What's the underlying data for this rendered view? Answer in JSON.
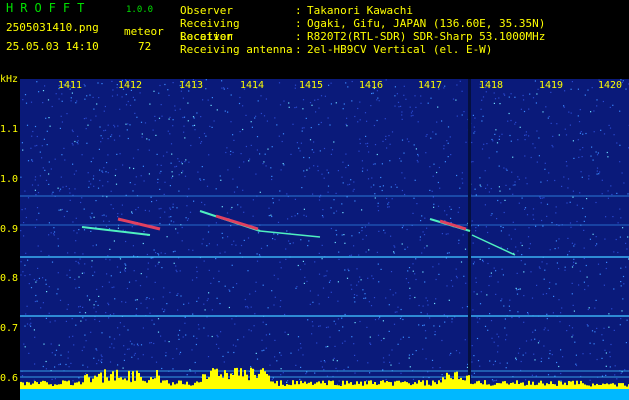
{
  "header": {
    "logo": "HROFFT",
    "version": "1.0.0",
    "filename": "2505031410.png",
    "datetime": "25.05.03 14:10",
    "meteor_label": "meteor",
    "meteor_count": "72"
  },
  "observation": [
    {
      "key": "Observer",
      "value": "Takanori Kawachi"
    },
    {
      "key": "Receiving Location",
      "value": "Ogaki, Gifu, JAPAN (136.60E, 35.35N)"
    },
    {
      "key": "Receiver",
      "value": "R820T2(RTL-SDR) SDR-Sharp 53.1000MHz"
    },
    {
      "key": "Receiving antenna",
      "value": "2el-HB9CV Vertical (el. E-W)"
    }
  ],
  "axis": {
    "y_unit": "kHz",
    "y_ticks": [
      "1.1",
      "1.0",
      "0.9",
      "0.8",
      "0.7",
      "0.6"
    ],
    "x_ticks": [
      "1411",
      "1412",
      "1413",
      "1414",
      "1415",
      "1416",
      "1417",
      "1418",
      "1419",
      "1420"
    ]
  },
  "colors": {
    "background": "#000000",
    "text": "#ffff00",
    "logo": "#00e000",
    "spectrogram": "#0a1a7a",
    "histogram": "#ffff00",
    "baseline": "#00c0ff"
  }
}
